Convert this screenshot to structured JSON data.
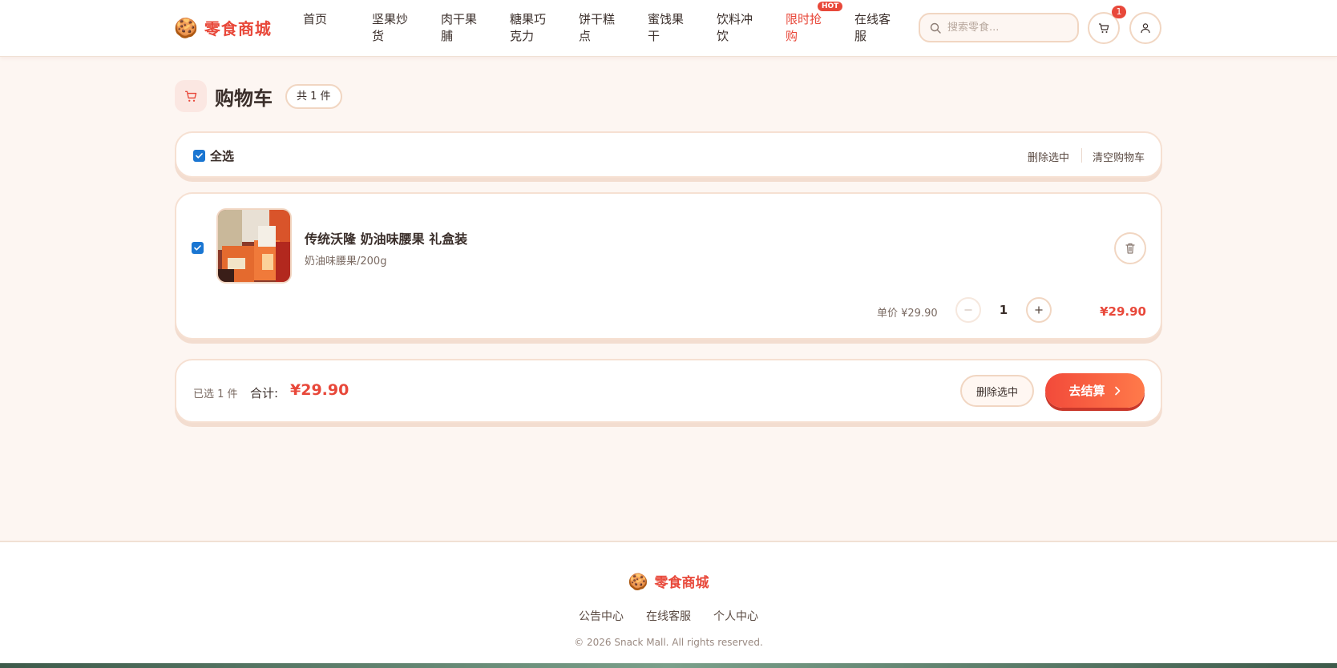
{
  "header": {
    "brand": "零食商城",
    "brand_icon": "🍪",
    "nav": [
      {
        "label": "首页",
        "hot": false
      },
      {
        "label": "坚果炒货",
        "hot": false
      },
      {
        "label": "肉干果脯",
        "hot": false
      },
      {
        "label": "糖果巧克力",
        "hot": false
      },
      {
        "label": "饼干糕点",
        "hot": false
      },
      {
        "label": "蜜饯果干",
        "hot": false
      },
      {
        "label": "饮料冲饮",
        "hot": false
      },
      {
        "label": "限时抢购",
        "hot": true,
        "badge": "HOT"
      },
      {
        "label": "在线客服",
        "hot": false
      }
    ],
    "search_placeholder": "搜索零食...",
    "cart_badge": "1"
  },
  "page": {
    "title": "购物车",
    "count_pill": "共 1 件"
  },
  "select_bar": {
    "select_all": "全选",
    "delete_selected": "删除选中",
    "clear_cart": "清空购物车"
  },
  "items": [
    {
      "name": "传统沃隆 奶油味腰果 礼盒装",
      "spec": "奶油味腰果/200g",
      "unit_price": "单价 ¥29.90",
      "quantity": "1",
      "subtotal": "¥29.90",
      "checked": true
    }
  ],
  "summary": {
    "selected_count": "已选 1 件",
    "total_label": "合计:",
    "total_value": "¥29.90",
    "delete_selected": "删除选中",
    "checkout": "去结算"
  },
  "footer": {
    "brand": "零食商城",
    "links": [
      "公告中心",
      "在线客服",
      "个人中心"
    ],
    "copyright": "© 2026 Snack Mall. All rights reserved."
  },
  "colors": {
    "accent": "#e8483a",
    "checkbox": "#1a76d2",
    "background": "#fdf6f2"
  }
}
